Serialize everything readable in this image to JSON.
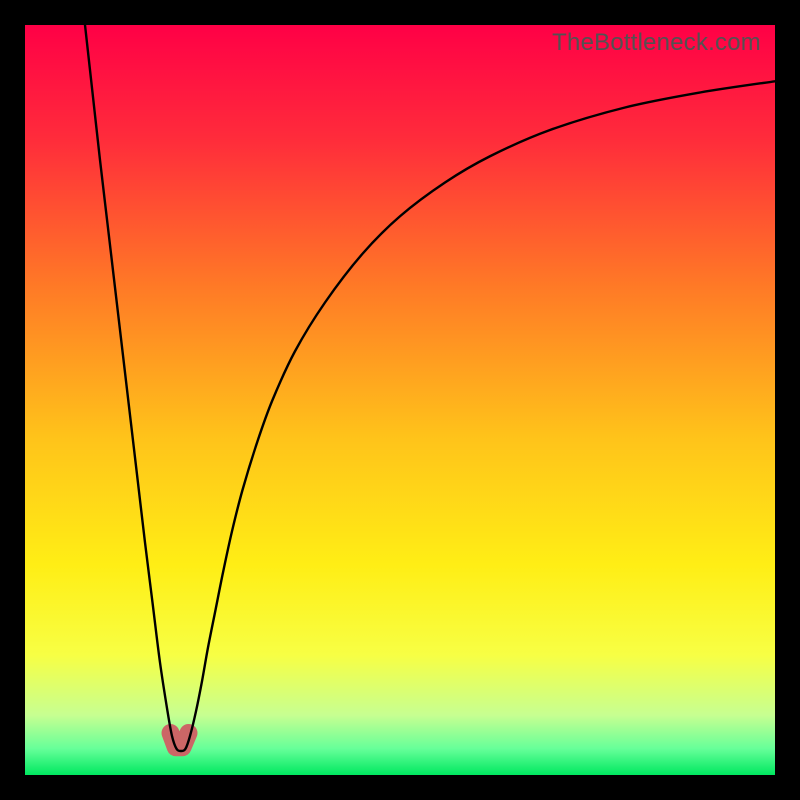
{
  "watermark": "TheBottleneck.com",
  "chart_data": {
    "type": "line",
    "title": "",
    "xlabel": "",
    "ylabel": "",
    "xlim": [
      0,
      100
    ],
    "ylim": [
      0,
      100
    ],
    "grid": false,
    "legend": false,
    "gradient_stops": [
      {
        "pos": 0.0,
        "color": "#ff0046"
      },
      {
        "pos": 0.15,
        "color": "#ff2b3b"
      },
      {
        "pos": 0.35,
        "color": "#ff7a26"
      },
      {
        "pos": 0.55,
        "color": "#ffc31a"
      },
      {
        "pos": 0.72,
        "color": "#ffee15"
      },
      {
        "pos": 0.84,
        "color": "#f7ff44"
      },
      {
        "pos": 0.92,
        "color": "#c7ff91"
      },
      {
        "pos": 0.965,
        "color": "#66ff99"
      },
      {
        "pos": 1.0,
        "color": "#00e860"
      }
    ],
    "series": [
      {
        "name": "bottleneck-curve",
        "color": "#000000",
        "width": 2.4,
        "x": [
          8,
          9,
          10,
          11,
          12,
          13,
          14,
          15,
          16,
          17,
          18,
          19,
          19.6,
          20.2,
          20.8,
          21.4,
          22.0,
          22.8,
          23.6,
          24.4,
          25.4,
          26.4,
          27.6,
          29.0,
          31,
          33,
          36,
          40,
          45,
          50,
          56,
          62,
          70,
          80,
          90,
          100
        ],
        "y": [
          100,
          91,
          82,
          73.5,
          65,
          56.5,
          48,
          39.5,
          31,
          23,
          15,
          8.5,
          5.2,
          3.5,
          3.2,
          3.5,
          5.2,
          8.5,
          12.5,
          17,
          22,
          27,
          32.5,
          38,
          44.5,
          50,
          56.5,
          63,
          69.5,
          74.5,
          79,
          82.5,
          86,
          89,
          91,
          92.5
        ]
      }
    ],
    "dip_marker": {
      "color": "#cc6666",
      "stroke": "#cc6666",
      "radius": 9,
      "points_x": [
        19.4,
        20.1,
        21.0,
        21.8
      ],
      "points_y": [
        5.6,
        3.7,
        3.7,
        5.6
      ]
    }
  }
}
